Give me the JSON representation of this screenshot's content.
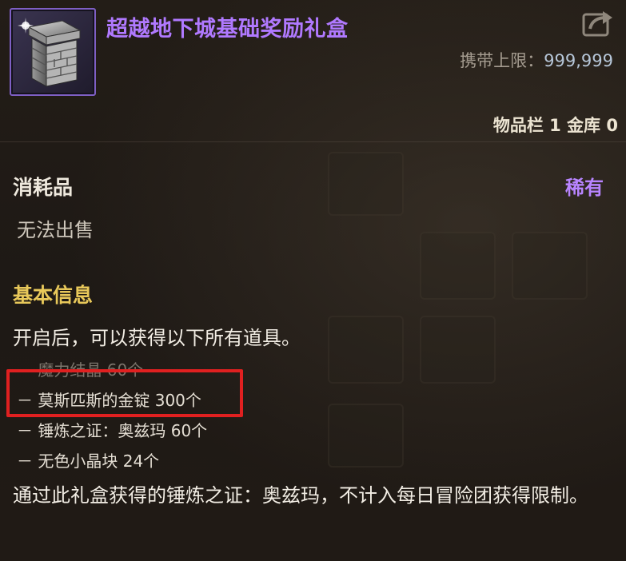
{
  "item": {
    "name": "超越地下城基础奖励礼盒",
    "carry_limit_label": "携带上限：",
    "carry_limit_value": "999,999",
    "storage_text": "物品栏 1 金库 0",
    "icon": "stone-gift-box-icon",
    "name_color": "#b079ff"
  },
  "meta": {
    "type": "消耗品",
    "rarity": "稀有",
    "sell_status": "无法出售"
  },
  "basic_info": {
    "title": "基本信息",
    "intro": "开启后，可以获得以下所有道具。",
    "items": [
      "－ 魔力结晶 60个",
      "－ 莫斯匹斯的金锭 300个",
      "－ 锤炼之证：奥兹玛 60个",
      "－ 无色小晶块 24个"
    ],
    "note": "通过此礼盒获得的锤炼之证：奥兹玛，不计入每日冒险团获得限制。"
  },
  "colors": {
    "rarity": "#b884ff",
    "section_title": "#e8c85a",
    "highlight": "#e02020"
  }
}
